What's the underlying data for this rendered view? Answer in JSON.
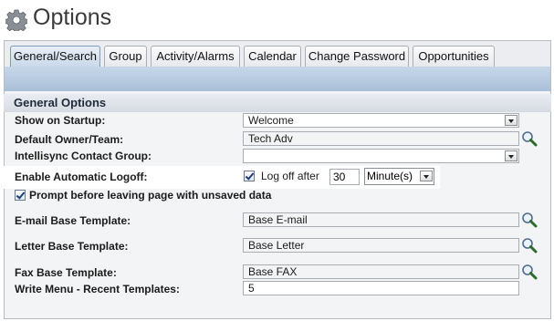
{
  "header": {
    "title": "Options",
    "icon": "gear-icon"
  },
  "tabs": [
    {
      "label": "General/Search",
      "active": true
    },
    {
      "label": "Group",
      "active": false
    },
    {
      "label": "Activity/Alarms",
      "active": false
    },
    {
      "label": "Calendar",
      "active": false
    },
    {
      "label": "Change Password",
      "active": false
    },
    {
      "label": "Opportunities",
      "active": false
    }
  ],
  "section": {
    "title": "General Options"
  },
  "fields": {
    "show_on_startup": {
      "label": "Show on Startup:",
      "value": "Welcome"
    },
    "default_owner": {
      "label": "Default Owner/Team:",
      "value": "Tech Adv"
    },
    "intellisync_group": {
      "label": "Intellisync Contact Group:",
      "value": ""
    },
    "auto_logoff": {
      "label": "Enable Automatic Logoff:",
      "checked": true,
      "text": "Log off after",
      "minutes": "30",
      "unit": "Minute(s)"
    },
    "prompt_unsaved": {
      "label": "Prompt before leaving page with unsaved data",
      "checked": true
    },
    "email_template": {
      "label": "E-mail Base Template:",
      "value": "Base E-mail"
    },
    "letter_template": {
      "label": "Letter Base Template:",
      "value": "Base Letter"
    },
    "fax_template": {
      "label": "Fax Base Template:",
      "value": "Base FAX"
    },
    "recent_templates": {
      "label": "Write Menu - Recent Templates:",
      "value": "5"
    }
  },
  "colors": {
    "active_tab": "#c8d8ea",
    "panel_bg": "#f3f4f6"
  }
}
